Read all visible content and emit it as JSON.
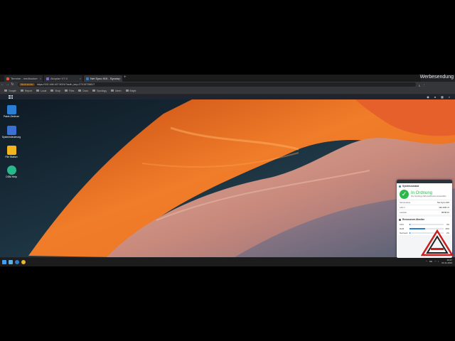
{
  "browser": {
    "tabs": [
      {
        "label": "Termine - medbooker",
        "favicon_color": "#e8542f"
      },
      {
        "label": "Akoplan V7.0",
        "favicon_color": "#7a6bd6"
      },
      {
        "label": "Net Syno 915 - Synology Mei",
        "favicon_color": "#2a7fd4"
      }
    ],
    "ad_label": "Werbesendung",
    "address": {
      "secure_label": "Nicht sicher",
      "url": "https://192.168.167.5001/?auth_key=27415728817"
    },
    "bookmarks": [
      "Google",
      "Report",
      "Local",
      "Shop",
      "Files",
      "Docs",
      "Synology",
      "Ideen",
      "Bright"
    ]
  },
  "dsm": {
    "desktop_icons": [
      {
        "label": "Paket-Zentrum",
        "color": "#2a7fd4"
      },
      {
        "label": "Systemsteuerung",
        "color": "#3b6fd1"
      },
      {
        "label": "File Station",
        "color": "#f2b51f"
      },
      {
        "label": "DSM Help",
        "color": "#28b98a"
      }
    ]
  },
  "widget": {
    "system_status": {
      "title": "Systemzustand",
      "status": "In Ordnung",
      "description": "Ihre Synology NAS funktioniert einwandfrei.",
      "rows": [
        {
          "key": "Servername",
          "value": "Net Syno 915"
        },
        {
          "key": "LAN 1",
          "value": "192.168.1.5"
        },
        {
          "key": "Laufzeit",
          "value": "88:58:10"
        }
      ]
    },
    "resource_monitor": {
      "title": "Ressourcen-Monitor",
      "meters": [
        {
          "label": "CPU",
          "value": 3
        },
        {
          "label": "RAM",
          "value": 45
        },
        {
          "label": "Netzwerk",
          "value": 2
        }
      ]
    }
  },
  "taskbar": {
    "time": "10:27",
    "date": "03.11.2023",
    "language": "DE"
  }
}
